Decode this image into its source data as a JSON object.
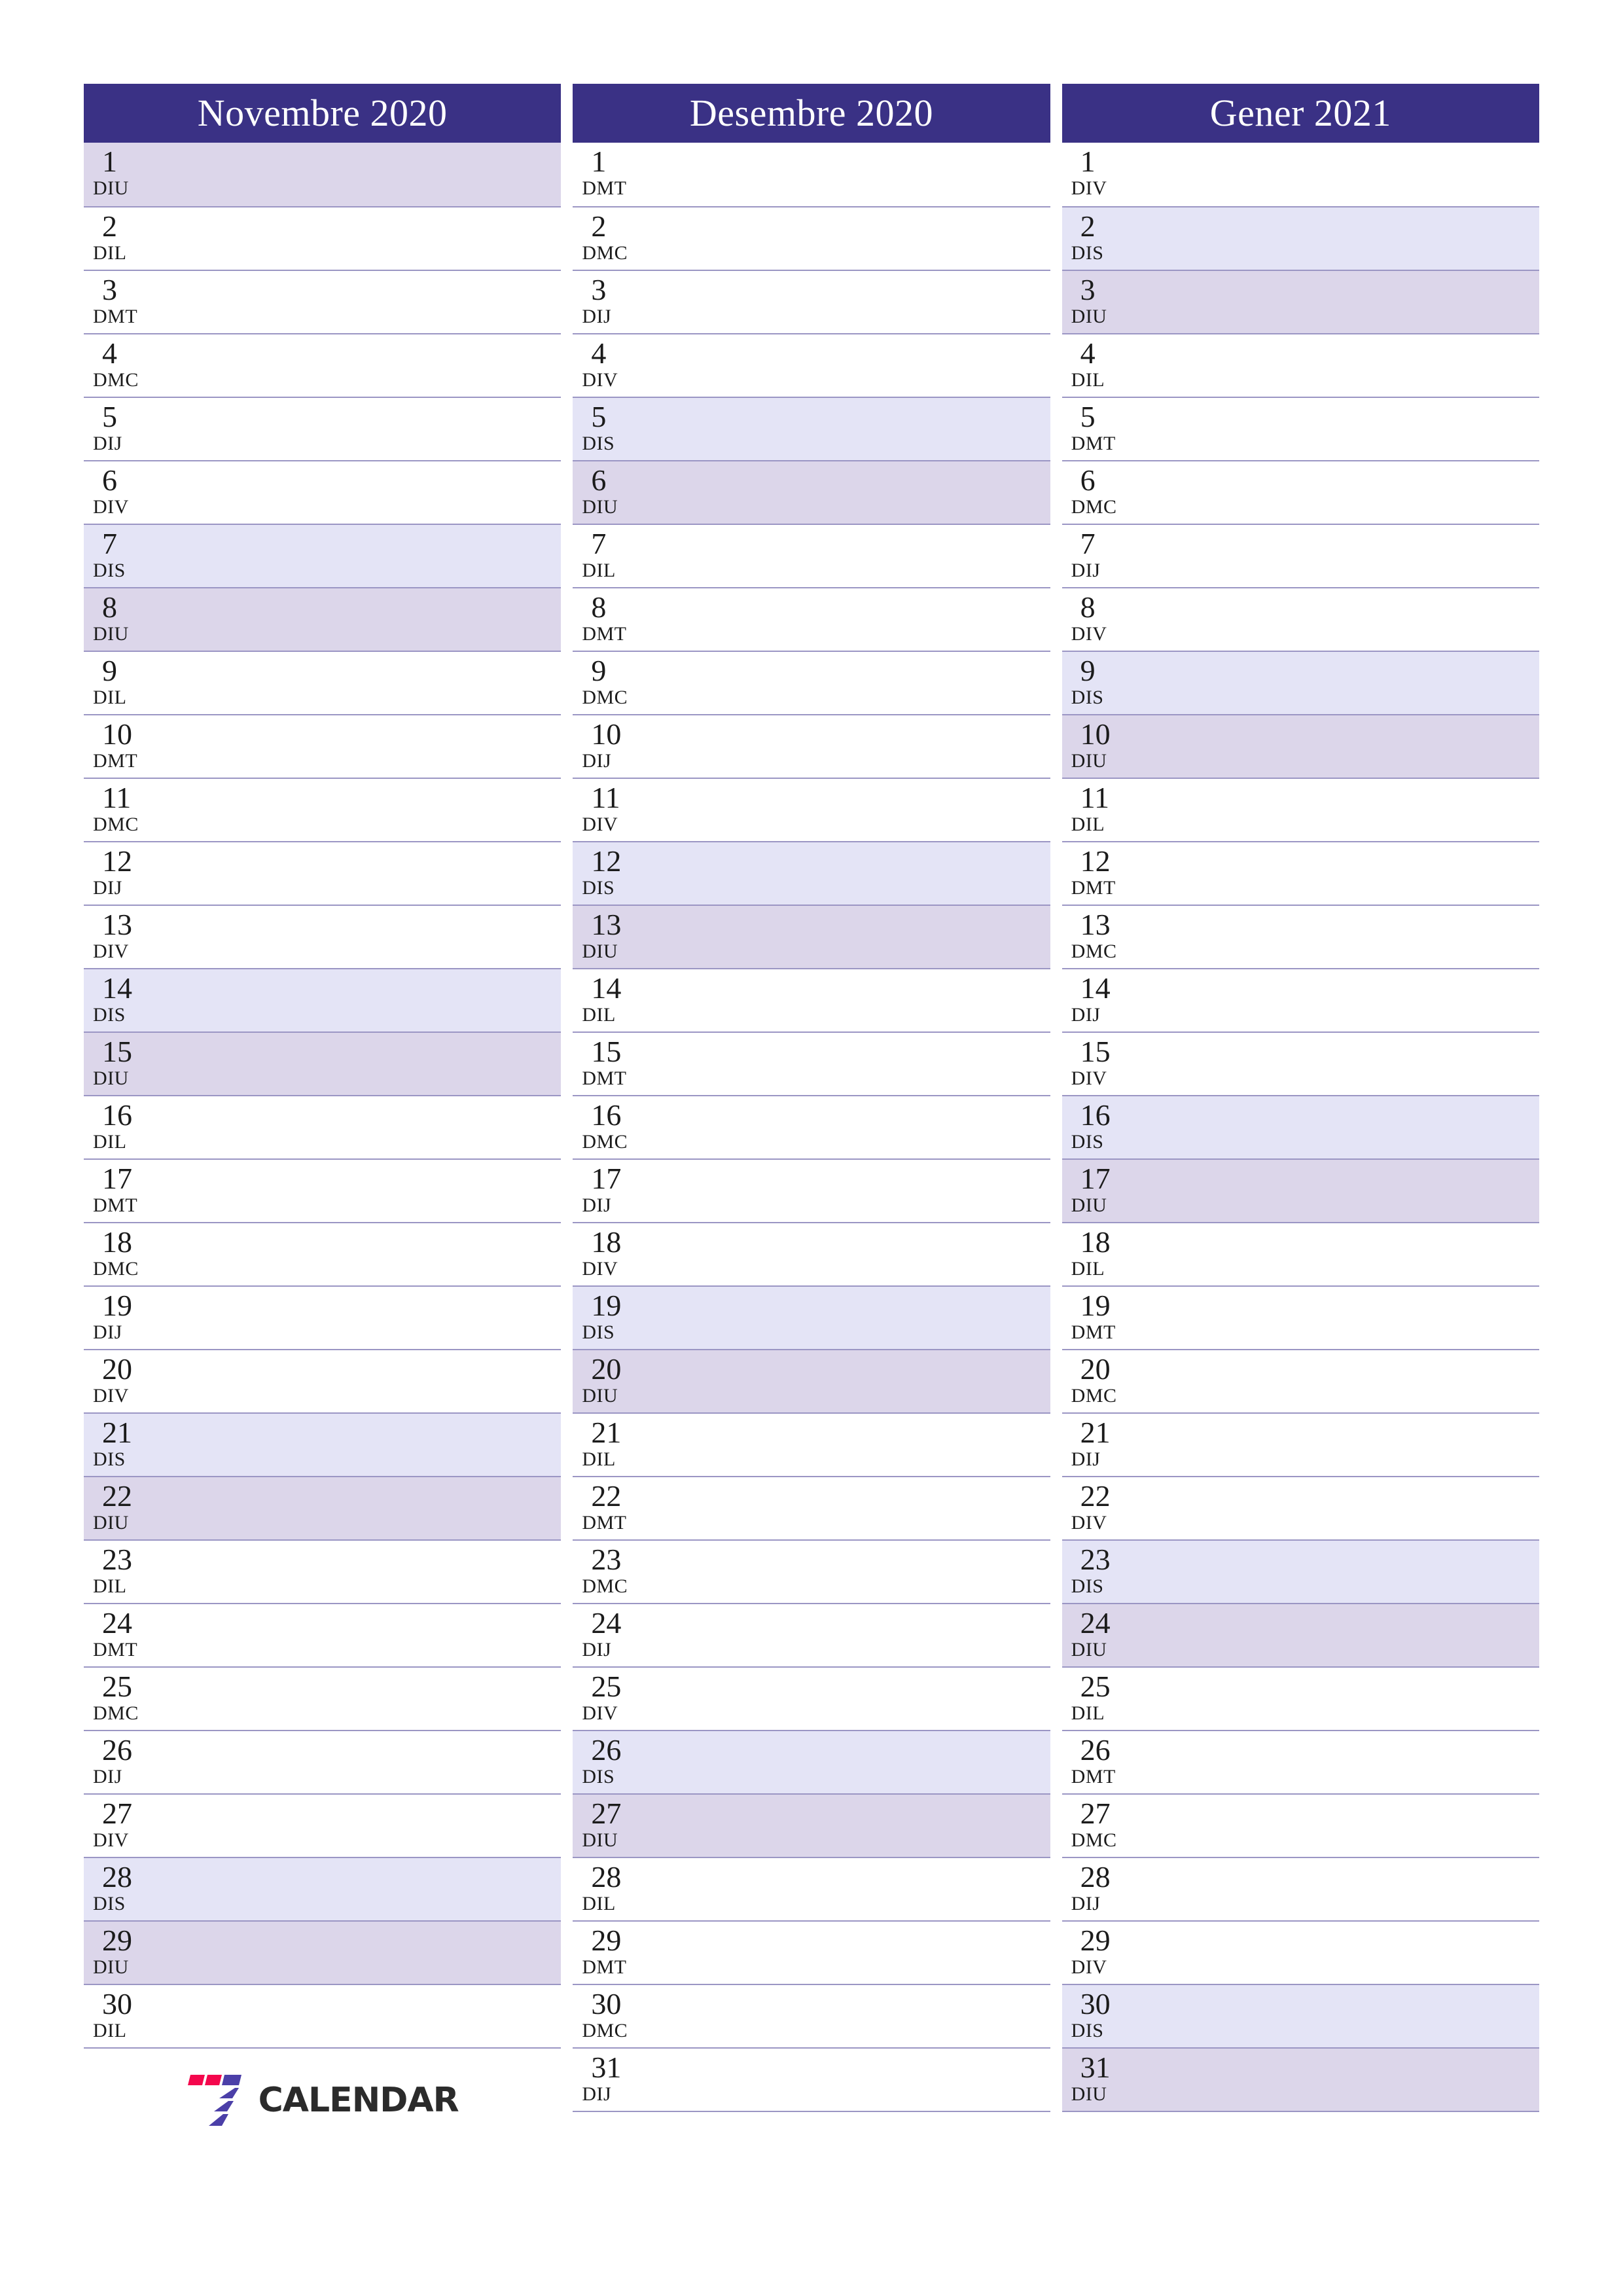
{
  "document": {
    "kind": "calendar-planner",
    "language": "ca",
    "orientation": "portrait"
  },
  "colors": {
    "header_background": "#3a3185",
    "header_text": "#ffffff",
    "saturday_background": "#e4e4f6",
    "sunday_background": "#dcd6ea",
    "row_divider": "#9b96c4",
    "text": "#1b1b1b",
    "logo_red": "#f4074d",
    "logo_purple": "#4b3fa8",
    "logo_word": "#2b2b2b"
  },
  "footer": {
    "logo_name": "seven-calendar-logo",
    "logo_word": "CALENDAR",
    "logo_digit": "7"
  },
  "months": [
    {
      "id": "november-2020",
      "title": "Novembre 2020",
      "days": [
        {
          "num": "1",
          "abbr": "DIU",
          "type": "sun"
        },
        {
          "num": "2",
          "abbr": "DIL",
          "type": "weekday"
        },
        {
          "num": "3",
          "abbr": "DMT",
          "type": "weekday"
        },
        {
          "num": "4",
          "abbr": "DMC",
          "type": "weekday"
        },
        {
          "num": "5",
          "abbr": "DIJ",
          "type": "weekday"
        },
        {
          "num": "6",
          "abbr": "DIV",
          "type": "weekday"
        },
        {
          "num": "7",
          "abbr": "DIS",
          "type": "sat"
        },
        {
          "num": "8",
          "abbr": "DIU",
          "type": "sun"
        },
        {
          "num": "9",
          "abbr": "DIL",
          "type": "weekday"
        },
        {
          "num": "10",
          "abbr": "DMT",
          "type": "weekday"
        },
        {
          "num": "11",
          "abbr": "DMC",
          "type": "weekday"
        },
        {
          "num": "12",
          "abbr": "DIJ",
          "type": "weekday"
        },
        {
          "num": "13",
          "abbr": "DIV",
          "type": "weekday"
        },
        {
          "num": "14",
          "abbr": "DIS",
          "type": "sat"
        },
        {
          "num": "15",
          "abbr": "DIU",
          "type": "sun"
        },
        {
          "num": "16",
          "abbr": "DIL",
          "type": "weekday"
        },
        {
          "num": "17",
          "abbr": "DMT",
          "type": "weekday"
        },
        {
          "num": "18",
          "abbr": "DMC",
          "type": "weekday"
        },
        {
          "num": "19",
          "abbr": "DIJ",
          "type": "weekday"
        },
        {
          "num": "20",
          "abbr": "DIV",
          "type": "weekday"
        },
        {
          "num": "21",
          "abbr": "DIS",
          "type": "sat"
        },
        {
          "num": "22",
          "abbr": "DIU",
          "type": "sun"
        },
        {
          "num": "23",
          "abbr": "DIL",
          "type": "weekday"
        },
        {
          "num": "24",
          "abbr": "DMT",
          "type": "weekday"
        },
        {
          "num": "25",
          "abbr": "DMC",
          "type": "weekday"
        },
        {
          "num": "26",
          "abbr": "DIJ",
          "type": "weekday"
        },
        {
          "num": "27",
          "abbr": "DIV",
          "type": "weekday"
        },
        {
          "num": "28",
          "abbr": "DIS",
          "type": "sat"
        },
        {
          "num": "29",
          "abbr": "DIU",
          "type": "sun"
        },
        {
          "num": "30",
          "abbr": "DIL",
          "type": "weekday"
        }
      ]
    },
    {
      "id": "december-2020",
      "title": "Desembre 2020",
      "days": [
        {
          "num": "1",
          "abbr": "DMT",
          "type": "weekday"
        },
        {
          "num": "2",
          "abbr": "DMC",
          "type": "weekday"
        },
        {
          "num": "3",
          "abbr": "DIJ",
          "type": "weekday"
        },
        {
          "num": "4",
          "abbr": "DIV",
          "type": "weekday"
        },
        {
          "num": "5",
          "abbr": "DIS",
          "type": "sat"
        },
        {
          "num": "6",
          "abbr": "DIU",
          "type": "sun"
        },
        {
          "num": "7",
          "abbr": "DIL",
          "type": "weekday"
        },
        {
          "num": "8",
          "abbr": "DMT",
          "type": "weekday"
        },
        {
          "num": "9",
          "abbr": "DMC",
          "type": "weekday"
        },
        {
          "num": "10",
          "abbr": "DIJ",
          "type": "weekday"
        },
        {
          "num": "11",
          "abbr": "DIV",
          "type": "weekday"
        },
        {
          "num": "12",
          "abbr": "DIS",
          "type": "sat"
        },
        {
          "num": "13",
          "abbr": "DIU",
          "type": "sun"
        },
        {
          "num": "14",
          "abbr": "DIL",
          "type": "weekday"
        },
        {
          "num": "15",
          "abbr": "DMT",
          "type": "weekday"
        },
        {
          "num": "16",
          "abbr": "DMC",
          "type": "weekday"
        },
        {
          "num": "17",
          "abbr": "DIJ",
          "type": "weekday"
        },
        {
          "num": "18",
          "abbr": "DIV",
          "type": "weekday"
        },
        {
          "num": "19",
          "abbr": "DIS",
          "type": "sat"
        },
        {
          "num": "20",
          "abbr": "DIU",
          "type": "sun"
        },
        {
          "num": "21",
          "abbr": "DIL",
          "type": "weekday"
        },
        {
          "num": "22",
          "abbr": "DMT",
          "type": "weekday"
        },
        {
          "num": "23",
          "abbr": "DMC",
          "type": "weekday"
        },
        {
          "num": "24",
          "abbr": "DIJ",
          "type": "weekday"
        },
        {
          "num": "25",
          "abbr": "DIV",
          "type": "weekday"
        },
        {
          "num": "26",
          "abbr": "DIS",
          "type": "sat"
        },
        {
          "num": "27",
          "abbr": "DIU",
          "type": "sun"
        },
        {
          "num": "28",
          "abbr": "DIL",
          "type": "weekday"
        },
        {
          "num": "29",
          "abbr": "DMT",
          "type": "weekday"
        },
        {
          "num": "30",
          "abbr": "DMC",
          "type": "weekday"
        },
        {
          "num": "31",
          "abbr": "DIJ",
          "type": "weekday"
        }
      ]
    },
    {
      "id": "january-2021",
      "title": "Gener 2021",
      "days": [
        {
          "num": "1",
          "abbr": "DIV",
          "type": "weekday"
        },
        {
          "num": "2",
          "abbr": "DIS",
          "type": "sat"
        },
        {
          "num": "3",
          "abbr": "DIU",
          "type": "sun"
        },
        {
          "num": "4",
          "abbr": "DIL",
          "type": "weekday"
        },
        {
          "num": "5",
          "abbr": "DMT",
          "type": "weekday"
        },
        {
          "num": "6",
          "abbr": "DMC",
          "type": "weekday"
        },
        {
          "num": "7",
          "abbr": "DIJ",
          "type": "weekday"
        },
        {
          "num": "8",
          "abbr": "DIV",
          "type": "weekday"
        },
        {
          "num": "9",
          "abbr": "DIS",
          "type": "sat"
        },
        {
          "num": "10",
          "abbr": "DIU",
          "type": "sun"
        },
        {
          "num": "11",
          "abbr": "DIL",
          "type": "weekday"
        },
        {
          "num": "12",
          "abbr": "DMT",
          "type": "weekday"
        },
        {
          "num": "13",
          "abbr": "DMC",
          "type": "weekday"
        },
        {
          "num": "14",
          "abbr": "DIJ",
          "type": "weekday"
        },
        {
          "num": "15",
          "abbr": "DIV",
          "type": "weekday"
        },
        {
          "num": "16",
          "abbr": "DIS",
          "type": "sat"
        },
        {
          "num": "17",
          "abbr": "DIU",
          "type": "sun"
        },
        {
          "num": "18",
          "abbr": "DIL",
          "type": "weekday"
        },
        {
          "num": "19",
          "abbr": "DMT",
          "type": "weekday"
        },
        {
          "num": "20",
          "abbr": "DMC",
          "type": "weekday"
        },
        {
          "num": "21",
          "abbr": "DIJ",
          "type": "weekday"
        },
        {
          "num": "22",
          "abbr": "DIV",
          "type": "weekday"
        },
        {
          "num": "23",
          "abbr": "DIS",
          "type": "sat"
        },
        {
          "num": "24",
          "abbr": "DIU",
          "type": "sun"
        },
        {
          "num": "25",
          "abbr": "DIL",
          "type": "weekday"
        },
        {
          "num": "26",
          "abbr": "DMT",
          "type": "weekday"
        },
        {
          "num": "27",
          "abbr": "DMC",
          "type": "weekday"
        },
        {
          "num": "28",
          "abbr": "DIJ",
          "type": "weekday"
        },
        {
          "num": "29",
          "abbr": "DIV",
          "type": "weekday"
        },
        {
          "num": "30",
          "abbr": "DIS",
          "type": "sat"
        },
        {
          "num": "31",
          "abbr": "DIU",
          "type": "sun"
        }
      ]
    }
  ]
}
